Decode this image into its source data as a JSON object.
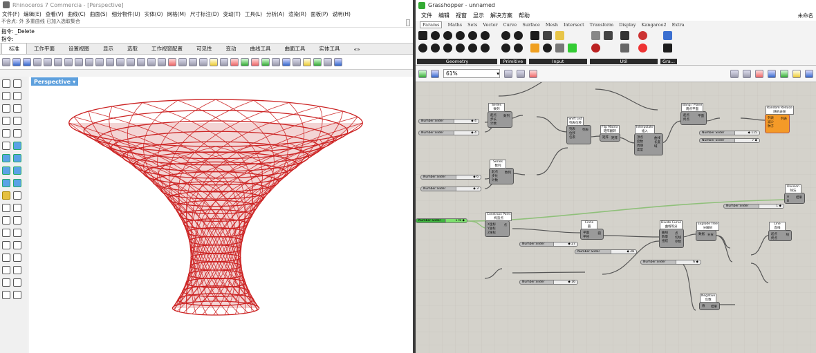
{
  "rhino": {
    "title": "Rhinoceros 7 Commercia - [Perspective]",
    "menu": [
      "文件(F)",
      "编辑(E)",
      "查看(V)",
      "曲线(C)",
      "曲面(S)",
      "细分物件(U)",
      "实体(O)",
      "网格(M)",
      "尺寸标注(D)",
      "变动(T)",
      "工具(L)",
      "分析(A)",
      "渲染(R)",
      "面板(P)",
      "说明(H)"
    ],
    "command_history": "不含点: 外 多重曲线 已加入选取集合",
    "command_label": "指令:",
    "command_value": "_Delete",
    "prompt": "指令:",
    "tabs": [
      "标准",
      "工作平面",
      "设置视图",
      "显示",
      "选取",
      "工作视窗配置",
      "可见性",
      "变动",
      "曲线工具",
      "曲面工具",
      "实体工具"
    ],
    "tab_more": "«»",
    "viewport_label": "Perspective",
    "accent": "#cc2222"
  },
  "gh": {
    "title": "Grasshopper - unnamed",
    "menu": [
      "文件",
      "编辑",
      "视窗",
      "显示",
      "解决方案",
      "帮助"
    ],
    "doc_name": "未命名",
    "tabs": [
      "Params",
      "Maths",
      "Sets",
      "Vector",
      "Curve",
      "Surface",
      "Mesh",
      "Intersect",
      "Transform",
      "Display",
      "Kangaroo2",
      "Extra"
    ],
    "ribbon_groups": [
      "Geometry",
      "Primitive",
      "Input",
      "Util",
      "Gra..."
    ],
    "zoom": "61%",
    "sliders": [
      {
        "label": "Number Slider",
        "value": "◆ 4"
      },
      {
        "label": "Number Slider",
        "value": "◆ 4"
      },
      {
        "label": "Number Slider",
        "value": "◆ 6"
      },
      {
        "label": "Number Slider",
        "value": "◆ 3"
      },
      {
        "label": "Number Slider",
        "value": "178 ◆"
      },
      {
        "label": "Number Slider",
        "value": "◆ 27"
      },
      {
        "label": "Number Slider",
        "value": "◆ 28"
      },
      {
        "label": "Number Slider",
        "value": "◆ 16"
      },
      {
        "label": "Number Slider",
        "value": "◆ 115"
      },
      {
        "label": "Number Slider",
        "value": "7 ◆"
      },
      {
        "label": "Number Slider",
        "value": "1 ◆"
      },
      {
        "label": "Number Slider",
        "value": "6 ◆"
      }
    ],
    "components": [
      {
        "title": "Series\n数列",
        "in": "起点\n步长\n计数",
        "out": "数列"
      },
      {
        "title": "Series\n数列",
        "in": "起点\n步长\n计数",
        "out": "数列"
      },
      {
        "title": "Shift List\n列表位移",
        "in": "列表\n位移\n包裹",
        "out": "列表"
      },
      {
        "title": "Flip Matrix\n矩阵翻转",
        "in": "矩阵",
        "out": "矩阵"
      },
      {
        "title": "Interpolate\n插入",
        "in": "顶点\n度数\n周期\n类型",
        "out": "曲线\n长度\n域"
      },
      {
        "title": "Bang / Plane\n两点平面",
        "in": "起点\n终点",
        "out": "平面"
      },
      {
        "title": "Random Reduce\n随机去除",
        "in": "列表\n减少\n种子",
        "out": "列表"
      },
      {
        "title": "Construct Point\n构造点",
        "in": "X坐标\nY坐标\nZ坐标",
        "out": "点"
      },
      {
        "title": "Circle\n圆",
        "in": "平面\n半径",
        "out": "圆"
      },
      {
        "title": "Divide Curve\n曲线等分",
        "in": "曲线\n数量\n扭结",
        "out": "点\n切线\n参数"
      },
      {
        "title": "Explode Tree\n分解树",
        "in": "数据",
        "out": "分支"
      },
      {
        "title": "Line\n直线",
        "in": "起点\n终点",
        "out": "线"
      },
      {
        "title": "Division\n除法",
        "in": "A\nB",
        "out": "结果"
      },
      {
        "title": "Negative\n负数",
        "in": "值",
        "out": "结果"
      }
    ]
  }
}
